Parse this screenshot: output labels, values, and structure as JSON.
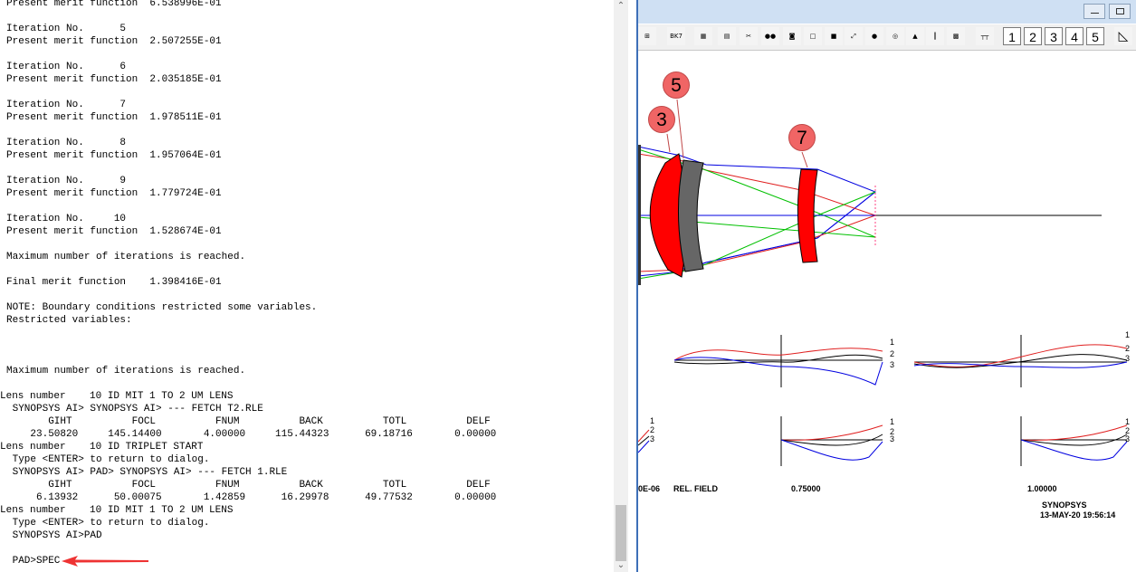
{
  "terminal": {
    "lines": [
      "Present merit function  6.538996E-01",
      "",
      "Iteration No.      5",
      "Present merit function  2.507255E-01",
      "",
      "Iteration No.      6",
      "Present merit function  2.035185E-01",
      "",
      "Iteration No.      7",
      "Present merit function  1.978511E-01",
      "",
      "Iteration No.      8",
      "Present merit function  1.957064E-01",
      "",
      "Iteration No.      9",
      "Present merit function  1.779724E-01",
      "",
      "Iteration No.     10",
      "Present merit function  1.528674E-01",
      "",
      "Maximum number of iterations is reached.",
      "",
      "Final merit function    1.398416E-01",
      "",
      "NOTE: Boundary conditions restricted some variables.",
      "Restricted variables:",
      "",
      "",
      "",
      "Maximum number of iterations is reached.",
      "",
      "Lens number    10 ID MIT 1 TO 2 UM LENS",
      " SYNOPSYS AI> SYNOPSYS AI> --- FETCH T2.RLE",
      "       GIHT          FOCL          FNUM          BACK          TOTL          DELF",
      "    23.50820     145.14400       4.00000     115.44323      69.18716       0.00000",
      "Lens number    10 ID TRIPLET START",
      " Type <ENTER> to return to dialog.",
      " SYNOPSYS AI> PAD> SYNOPSYS AI> --- FETCH 1.RLE",
      "       GIHT          FOCL          FNUM          BACK          TOTL          DELF",
      "     6.13932      50.00075       1.42859      16.29978      49.77532       0.00000",
      "Lens number    10 ID MIT 1 TO 2 UM LENS",
      " Type <ENTER> to return to dialog.",
      " SYNOPSYS AI>PAD",
      "",
      " PAD>SPEC"
    ]
  },
  "scrollbar": {
    "up": "⌃",
    "down": "⌄"
  },
  "pad_window": {
    "toolbar_buttons": [
      {
        "name": "edit-lens-tool",
        "label": "⊞"
      },
      {
        "name": "bk7-glass-tool",
        "label": "BK7"
      },
      {
        "name": "grid-tool",
        "label": "▦"
      },
      {
        "name": "table-tool",
        "label": "▤"
      },
      {
        "name": "scissors-tool",
        "label": "✂"
      },
      {
        "name": "dots-tool",
        "label": "●●"
      },
      {
        "name": "camera-tool",
        "label": "◙"
      },
      {
        "name": "frame-tool",
        "label": "□"
      },
      {
        "name": "black-fill-tool",
        "label": "■"
      },
      {
        "name": "expand-tool",
        "label": "⤢"
      },
      {
        "name": "red-dot-tool",
        "label": "●"
      },
      {
        "name": "circle-tool",
        "label": "◎"
      },
      {
        "name": "rgb-tool",
        "label": "▲"
      },
      {
        "name": "bars-tool",
        "label": "║"
      },
      {
        "name": "hatch-tool",
        "label": "▩"
      },
      {
        "name": "ruler-tool",
        "label": "┬┬"
      }
    ],
    "number_buttons": [
      "1",
      "2",
      "3",
      "4",
      "5"
    ],
    "wedge_tool": "◺",
    "badges": [
      "5",
      "3",
      "7"
    ],
    "curve_labels": [
      "1",
      "2",
      "3"
    ],
    "field_labels": {
      "left_value": "0E-06",
      "rel_field_label": "REL. FIELD",
      "mid_value": "0.75000",
      "right_value": "1.00000"
    },
    "footer": {
      "brand": "SYNOPSYS",
      "timestamp": "13-MAY-20  19:56:14"
    },
    "colors": {
      "element_red": "#ff0000",
      "element_gray": "#666666",
      "ray_blue": "#0000e0",
      "ray_red": "#e02020",
      "ray_green": "#00c000",
      "badge": "#f06565"
    }
  }
}
